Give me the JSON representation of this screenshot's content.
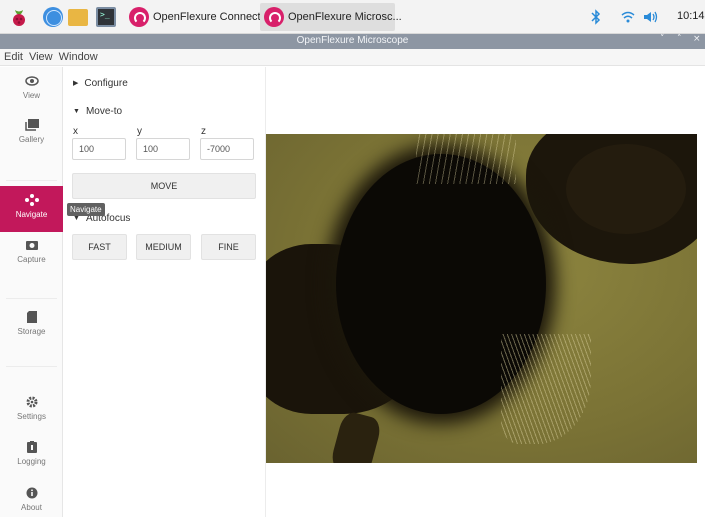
{
  "taskbar": {
    "tasks": [
      {
        "label": "OpenFlexure Connect",
        "active": false
      },
      {
        "label": "OpenFlexure Microsc...",
        "active": true
      }
    ],
    "icons": [
      "raspberry-icon",
      "globe-icon",
      "folder-icon",
      "terminal-icon"
    ],
    "tray": [
      "bluetooth-icon",
      "wifi-icon",
      "volume-icon"
    ],
    "clock": "10:14"
  },
  "window": {
    "title": "OpenFlexure Microscope",
    "controls": {
      "minimize": "˅",
      "maximize": "˄",
      "close": "×"
    }
  },
  "menu": {
    "items": [
      "Edit",
      "View",
      "Window"
    ]
  },
  "sidebar": {
    "items": [
      {
        "label": "View",
        "icon": "eye-icon"
      },
      {
        "label": "Gallery",
        "icon": "gallery-icon"
      },
      {
        "label": "Navigate",
        "icon": "move-icon",
        "active": true
      },
      {
        "label": "Capture",
        "icon": "camera-icon"
      },
      {
        "label": "Storage",
        "icon": "sd-card-icon"
      },
      {
        "label": "Settings",
        "icon": "gear-icon"
      },
      {
        "label": "Logging",
        "icon": "clipboard-icon"
      },
      {
        "label": "About",
        "icon": "info-icon"
      }
    ],
    "active_color": "#c2185b",
    "tooltip": "Navigate"
  },
  "panel": {
    "configure": {
      "label": "Configure",
      "expanded": false
    },
    "move_to": {
      "label": "Move-to",
      "expanded": true,
      "axes": [
        {
          "label": "x",
          "value": "100"
        },
        {
          "label": "y",
          "value": "100"
        },
        {
          "label": "z",
          "value": "-7000"
        }
      ],
      "move_label": "MOVE"
    },
    "autofocus": {
      "label": "Autofocus",
      "expanded": true,
      "buttons": [
        "FAST",
        "MEDIUM",
        "FINE"
      ]
    }
  }
}
